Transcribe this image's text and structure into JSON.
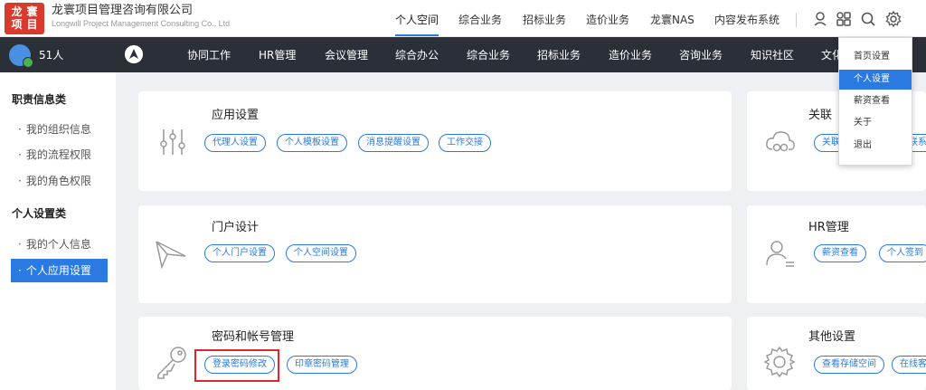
{
  "company": {
    "name_cn": "龙寰项目管理咨询有限公司",
    "name_en": "Longwill Project Management Consulting Co., Ltd"
  },
  "top_nav": [
    "个人空间",
    "综合业务",
    "招标业务",
    "造价业务",
    "龙寰NAS",
    "内容发布系统"
  ],
  "top_nav_active": "个人空间",
  "top_icons": [
    "user-location-icon",
    "apps-grid-icon",
    "search-icon",
    "gear-icon"
  ],
  "user": {
    "count": "51人"
  },
  "main_nav": [
    "协同工作",
    "HR管理",
    "会议管理",
    "综合办公",
    "综合业务",
    "招标业务",
    "造价业务",
    "咨询业务",
    "知识社区",
    "文化"
  ],
  "sidebar": {
    "categories": [
      {
        "title": "职责信息类",
        "items": [
          "我的组织信息",
          "我的流程权限",
          "我的角色权限"
        ]
      },
      {
        "title": "个人设置类",
        "items": [
          "我的个人信息",
          "个人应用设置"
        ]
      }
    ],
    "active_item": "个人应用设置"
  },
  "cards": [
    {
      "title": "应用设置",
      "icon": "sliders-icon",
      "tags": [
        "代理人设置",
        "个人模板设置",
        "消息提醒设置",
        "工作交接"
      ]
    },
    {
      "title": "关联",
      "icon": "cloud-link-icon",
      "tags": [
        "关联",
        "联系"
      ]
    },
    {
      "title": "门户设计",
      "icon": "paper-plane-icon",
      "tags": [
        "个人门户设置",
        "个人空间设置"
      ]
    },
    {
      "title": "HR管理",
      "icon": "user-profile-icon",
      "tags": [
        "薪资查看",
        "个人签到"
      ]
    },
    {
      "title": "密码和帐号管理",
      "icon": "key-icon",
      "tags": [
        "登录密码修改",
        "印章密码管理"
      ]
    },
    {
      "title": "其他设置",
      "icon": "settings-gear-icon",
      "tags": [
        "查看存储空间",
        "在线客"
      ]
    }
  ],
  "dropdown": {
    "items": [
      "首页设置",
      "个人设置",
      "薪资查看",
      "关于",
      "退出"
    ],
    "active": "个人设置"
  },
  "colors": {
    "accent": "#2a7ae2",
    "dark_nav": "#2b2f38",
    "highlight": "#e0262a",
    "logo": "#d83a2e"
  }
}
